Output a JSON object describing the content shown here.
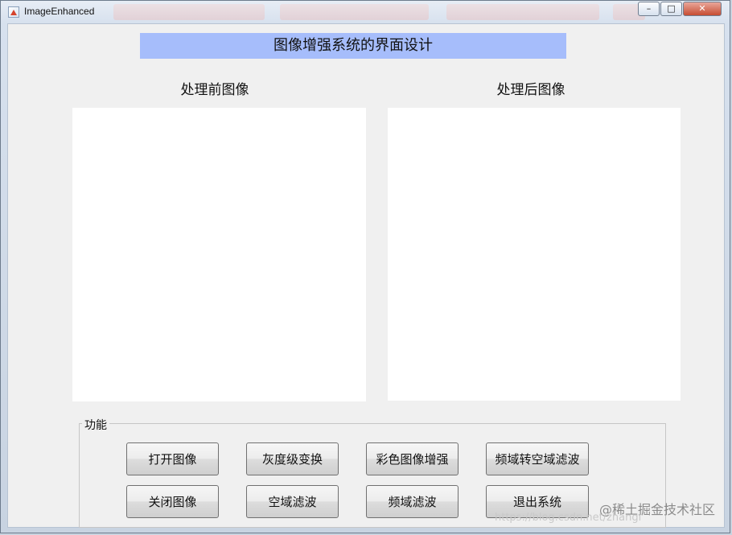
{
  "window": {
    "title": "ImageEnhanced",
    "controls": [
      "–",
      "□",
      "✕"
    ]
  },
  "header": {
    "banner": "图像增强系统的界面设计"
  },
  "axes": {
    "before_title": "处理前图像",
    "after_title": "处理后图像"
  },
  "panel": {
    "title": "功能",
    "buttons": [
      "打开图像",
      "灰度级变换",
      "彩色图像增强",
      "频域转空域滤波",
      "关闭图像",
      "空域滤波",
      "频域滤波",
      "退出系统"
    ]
  },
  "watermark": {
    "text": "@稀土掘金技术社区",
    "url": "https://blog.csdn.net/zhangi"
  }
}
